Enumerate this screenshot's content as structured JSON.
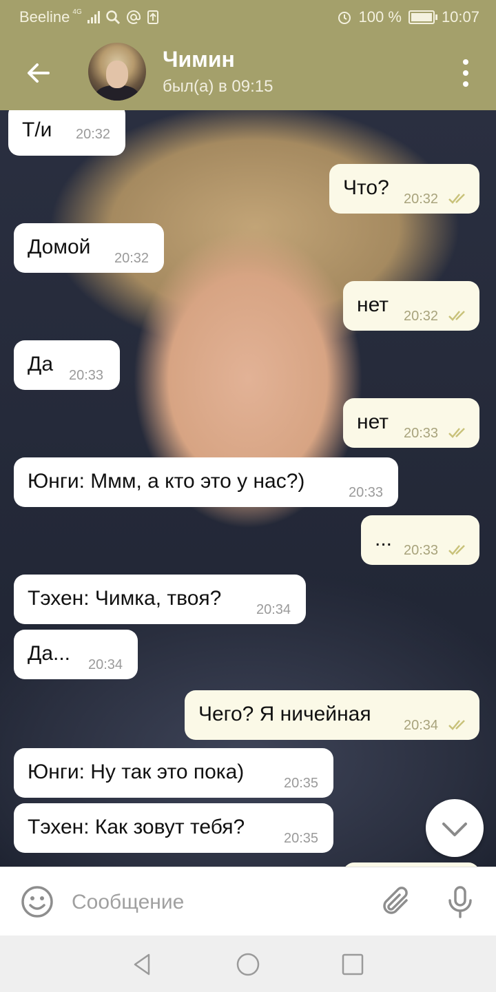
{
  "status": {
    "carrier": "Beeline",
    "network": "4G",
    "battery": "100 %",
    "time": "10:07"
  },
  "header": {
    "contact_name": "Чимин",
    "last_seen": "был(а) в 09:15"
  },
  "messages": [
    {
      "dir": "in",
      "text": "Т/и",
      "time": "20:32"
    },
    {
      "dir": "out",
      "text": "Что?",
      "time": "20:32"
    },
    {
      "dir": "in",
      "text": "Домой",
      "time": "20:32"
    },
    {
      "dir": "out",
      "text": "нет",
      "time": "20:32"
    },
    {
      "dir": "in",
      "text": "Да",
      "time": "20:33"
    },
    {
      "dir": "out",
      "text": "нет",
      "time": "20:33"
    },
    {
      "dir": "in",
      "text": "Юнги: Ммм, а кто это у нас?)",
      "time": "20:33"
    },
    {
      "dir": "out",
      "text": "...",
      "time": "20:33"
    },
    {
      "dir": "in",
      "text": "Тэхен: Чимка, твоя?",
      "time": "20:34"
    },
    {
      "dir": "in",
      "text": "Да...",
      "time": "20:34"
    },
    {
      "dir": "out",
      "text": "Чего? Я ничейная",
      "time": "20:34"
    },
    {
      "dir": "in",
      "text": "Юнги: Ну так это пока)",
      "time": "20:35"
    },
    {
      "dir": "in",
      "text": "Тэхен: Как зовут тебя?",
      "time": "20:35"
    }
  ],
  "composer": {
    "placeholder": "Сообщение"
  },
  "colors": {
    "accent": "#a4a06b",
    "incoming_bubble": "#ffffff",
    "outgoing_bubble": "#fbf9e7",
    "read_check": "#c9c27a"
  },
  "icons": {
    "back": "arrow-left-icon",
    "menu": "more-vert-icon",
    "emoji": "smiley-icon",
    "attach": "paperclip-icon",
    "mic": "microphone-icon",
    "scroll_down": "chevron-down-icon",
    "nav_back": "triangle-back-icon",
    "nav_home": "circle-home-icon",
    "nav_recent": "square-recent-icon"
  }
}
